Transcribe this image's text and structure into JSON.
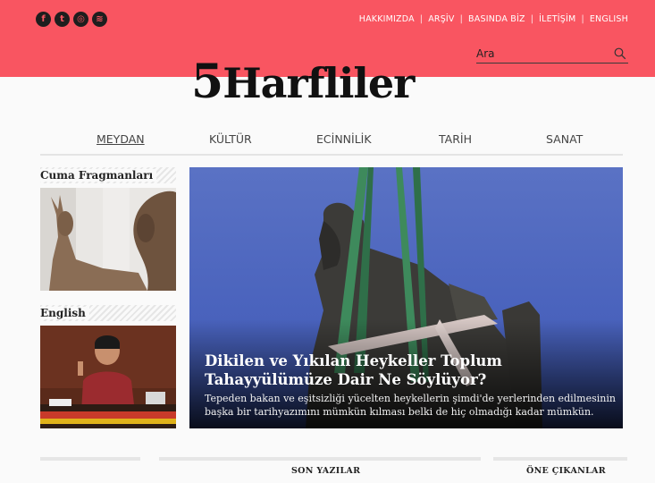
{
  "social": {
    "icons": [
      "facebook-icon",
      "twitter-icon",
      "instagram-icon",
      "rss-icon"
    ],
    "glyphs": [
      "f",
      "t",
      "◎",
      "≋"
    ]
  },
  "topnav": {
    "items": [
      "HAKKIMIZDA",
      "ARŞİV",
      "BASINDA BİZ",
      "İLETİŞİM",
      "ENGLISH"
    ],
    "separator": "|"
  },
  "search": {
    "placeholder": "Ara",
    "icon": "search-icon"
  },
  "logo": {
    "number": "5",
    "name": "Harfliler"
  },
  "mainnav": {
    "items": [
      "MEYDAN",
      "KÜLTÜR",
      "ECİNNİLİK",
      "TARİH",
      "SANAT"
    ],
    "active": "MEYDAN"
  },
  "sidebar": {
    "sections": [
      {
        "title": "Cuma Fragmanları"
      },
      {
        "title": "English"
      }
    ]
  },
  "hero": {
    "title": "Dikilen ve Yıkılan Heykeller Toplum Tahayyülümüze Dair Ne Söylüyor?",
    "excerpt": "Tepeden bakan ve eşitsizliği yücelten heykellerin şimdi'de yerlerinden edilmesinin başka bir tarihyazımını mümkün kılması belki de hiç olmadığı kadar mümkün."
  },
  "bottom": {
    "son_yazilar": "SON YAZILAR",
    "one_cikanlar": "ÖNE ÇIKANLAR"
  },
  "colors": {
    "topbar": "#f95561",
    "hero_sky": "#4a63bd"
  }
}
